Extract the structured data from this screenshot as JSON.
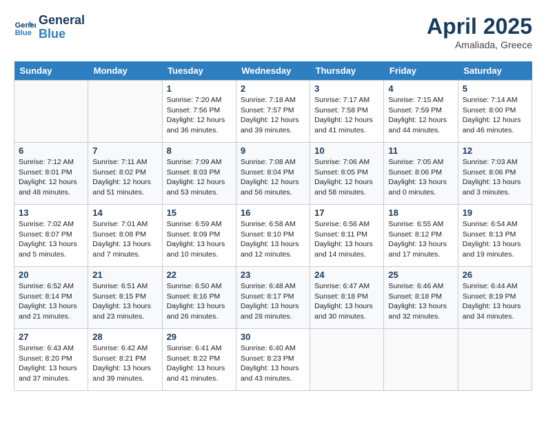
{
  "header": {
    "logo_line1": "General",
    "logo_line2": "Blue",
    "month": "April 2025",
    "location": "Amaliada, Greece"
  },
  "weekdays": [
    "Sunday",
    "Monday",
    "Tuesday",
    "Wednesday",
    "Thursday",
    "Friday",
    "Saturday"
  ],
  "weeks": [
    [
      {
        "day": "",
        "info": ""
      },
      {
        "day": "",
        "info": ""
      },
      {
        "day": "1",
        "info": "Sunrise: 7:20 AM\nSunset: 7:56 PM\nDaylight: 12 hours and 36 minutes."
      },
      {
        "day": "2",
        "info": "Sunrise: 7:18 AM\nSunset: 7:57 PM\nDaylight: 12 hours and 39 minutes."
      },
      {
        "day": "3",
        "info": "Sunrise: 7:17 AM\nSunset: 7:58 PM\nDaylight: 12 hours and 41 minutes."
      },
      {
        "day": "4",
        "info": "Sunrise: 7:15 AM\nSunset: 7:59 PM\nDaylight: 12 hours and 44 minutes."
      },
      {
        "day": "5",
        "info": "Sunrise: 7:14 AM\nSunset: 8:00 PM\nDaylight: 12 hours and 46 minutes."
      }
    ],
    [
      {
        "day": "6",
        "info": "Sunrise: 7:12 AM\nSunset: 8:01 PM\nDaylight: 12 hours and 48 minutes."
      },
      {
        "day": "7",
        "info": "Sunrise: 7:11 AM\nSunset: 8:02 PM\nDaylight: 12 hours and 51 minutes."
      },
      {
        "day": "8",
        "info": "Sunrise: 7:09 AM\nSunset: 8:03 PM\nDaylight: 12 hours and 53 minutes."
      },
      {
        "day": "9",
        "info": "Sunrise: 7:08 AM\nSunset: 8:04 PM\nDaylight: 12 hours and 56 minutes."
      },
      {
        "day": "10",
        "info": "Sunrise: 7:06 AM\nSunset: 8:05 PM\nDaylight: 12 hours and 58 minutes."
      },
      {
        "day": "11",
        "info": "Sunrise: 7:05 AM\nSunset: 8:06 PM\nDaylight: 13 hours and 0 minutes."
      },
      {
        "day": "12",
        "info": "Sunrise: 7:03 AM\nSunset: 8:06 PM\nDaylight: 13 hours and 3 minutes."
      }
    ],
    [
      {
        "day": "13",
        "info": "Sunrise: 7:02 AM\nSunset: 8:07 PM\nDaylight: 13 hours and 5 minutes."
      },
      {
        "day": "14",
        "info": "Sunrise: 7:01 AM\nSunset: 8:08 PM\nDaylight: 13 hours and 7 minutes."
      },
      {
        "day": "15",
        "info": "Sunrise: 6:59 AM\nSunset: 8:09 PM\nDaylight: 13 hours and 10 minutes."
      },
      {
        "day": "16",
        "info": "Sunrise: 6:58 AM\nSunset: 8:10 PM\nDaylight: 13 hours and 12 minutes."
      },
      {
        "day": "17",
        "info": "Sunrise: 6:56 AM\nSunset: 8:11 PM\nDaylight: 13 hours and 14 minutes."
      },
      {
        "day": "18",
        "info": "Sunrise: 6:55 AM\nSunset: 8:12 PM\nDaylight: 13 hours and 17 minutes."
      },
      {
        "day": "19",
        "info": "Sunrise: 6:54 AM\nSunset: 8:13 PM\nDaylight: 13 hours and 19 minutes."
      }
    ],
    [
      {
        "day": "20",
        "info": "Sunrise: 6:52 AM\nSunset: 8:14 PM\nDaylight: 13 hours and 21 minutes."
      },
      {
        "day": "21",
        "info": "Sunrise: 6:51 AM\nSunset: 8:15 PM\nDaylight: 13 hours and 23 minutes."
      },
      {
        "day": "22",
        "info": "Sunrise: 6:50 AM\nSunset: 8:16 PM\nDaylight: 13 hours and 26 minutes."
      },
      {
        "day": "23",
        "info": "Sunrise: 6:48 AM\nSunset: 8:17 PM\nDaylight: 13 hours and 28 minutes."
      },
      {
        "day": "24",
        "info": "Sunrise: 6:47 AM\nSunset: 8:18 PM\nDaylight: 13 hours and 30 minutes."
      },
      {
        "day": "25",
        "info": "Sunrise: 6:46 AM\nSunset: 8:18 PM\nDaylight: 13 hours and 32 minutes."
      },
      {
        "day": "26",
        "info": "Sunrise: 6:44 AM\nSunset: 8:19 PM\nDaylight: 13 hours and 34 minutes."
      }
    ],
    [
      {
        "day": "27",
        "info": "Sunrise: 6:43 AM\nSunset: 8:20 PM\nDaylight: 13 hours and 37 minutes."
      },
      {
        "day": "28",
        "info": "Sunrise: 6:42 AM\nSunset: 8:21 PM\nDaylight: 13 hours and 39 minutes."
      },
      {
        "day": "29",
        "info": "Sunrise: 6:41 AM\nSunset: 8:22 PM\nDaylight: 13 hours and 41 minutes."
      },
      {
        "day": "30",
        "info": "Sunrise: 6:40 AM\nSunset: 8:23 PM\nDaylight: 13 hours and 43 minutes."
      },
      {
        "day": "",
        "info": ""
      },
      {
        "day": "",
        "info": ""
      },
      {
        "day": "",
        "info": ""
      }
    ]
  ]
}
